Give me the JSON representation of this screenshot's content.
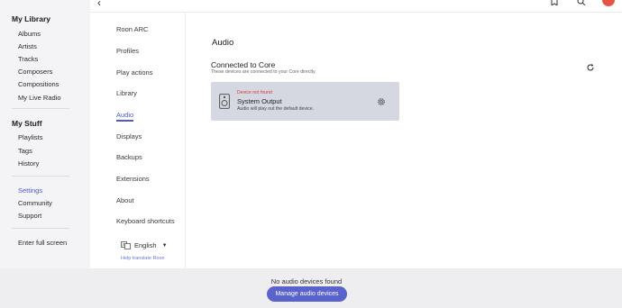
{
  "sidebar": {
    "library_heading": "My Library",
    "library_items": [
      "Albums",
      "Artists",
      "Tracks",
      "Composers",
      "Compositions",
      "My Live Radio"
    ],
    "stuff_heading": "My Stuff",
    "stuff_items": [
      "Playlists",
      "Tags",
      "History"
    ],
    "misc_items": [
      "Settings",
      "Community",
      "Support"
    ],
    "fullscreen": "Enter full screen"
  },
  "settings_nav": {
    "items": [
      "Roon ARC",
      "Profiles",
      "Play actions",
      "Library",
      "Audio",
      "Displays",
      "Backups",
      "Extensions",
      "About",
      "Keyboard shortcuts"
    ],
    "language": "English",
    "help_translate": "Help translate Roon"
  },
  "main": {
    "title": "Audio",
    "core_title": "Connected to Core",
    "core_desc": "These devices are connected to your Core directly.",
    "device": {
      "status": "Device not found",
      "name": "System Output",
      "note": "Audio will play out the default device."
    }
  },
  "bottom": {
    "message": "No audio devices found",
    "button": "Manage audio devices"
  },
  "colors": {
    "accent": "#4d5bc8",
    "error": "#d23c3c",
    "button": "#5a63cc"
  },
  "icons": [
    "back-icon",
    "bookmark-icon",
    "search-icon",
    "refresh-icon",
    "speaker-icon",
    "gear-icon",
    "translate-icon"
  ]
}
